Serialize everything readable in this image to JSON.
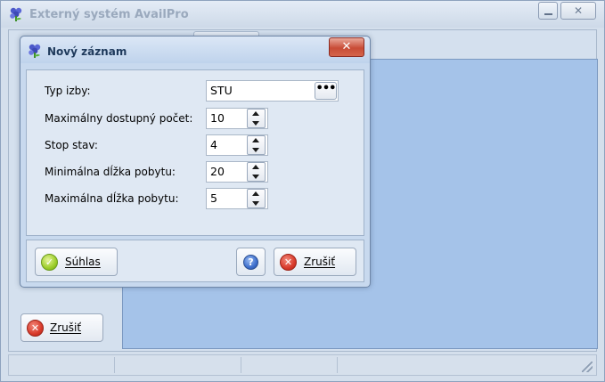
{
  "main_window": {
    "title": "Externý systém AvailPro",
    "close_glyph": "✕",
    "cancel_label": "Zrušiť"
  },
  "dialog": {
    "title": "Nový záznam",
    "close_glyph": "✕",
    "fields": [
      {
        "label": "Typ izby:",
        "value": "STU",
        "kind": "lookup",
        "button_label": "•••"
      },
      {
        "label": "Maximálny dostupný počet:",
        "value": "10",
        "kind": "spinner"
      },
      {
        "label": "Stop stav:",
        "value": "4",
        "kind": "spinner"
      },
      {
        "label": "Minimálna dĺžka pobytu:",
        "value": "20",
        "kind": "spinner"
      },
      {
        "label": "Maximálna dĺžka pobytu:",
        "value": "5",
        "kind": "spinner"
      }
    ],
    "ok_label": "Súhlas",
    "help_glyph": "?",
    "cancel_label": "Zrušiť"
  },
  "icons": {
    "app": "app-flower-icon",
    "ok": "checkmark-icon",
    "cancel": "close-x-icon",
    "help": "help-icon"
  },
  "colors": {
    "dialog_close_red": "#c84c36",
    "panel_blue": "#a5c3e9",
    "ok_green": "#9ccd2a",
    "cancel_red": "#d83a2b",
    "help_blue": "#3e6fcd"
  }
}
